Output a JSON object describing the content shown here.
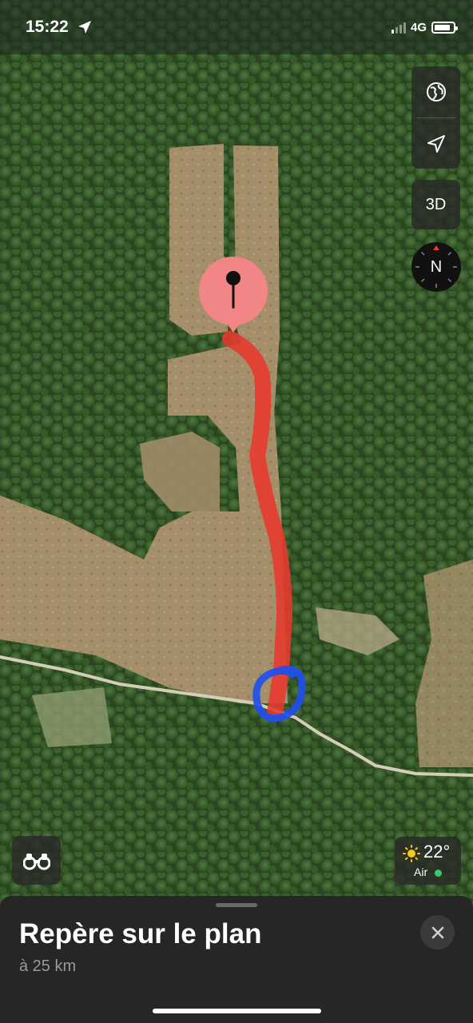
{
  "status_bar": {
    "time": "15:22",
    "network": "4G"
  },
  "map_controls": {
    "three_d_label": "3D",
    "compass_label": "N"
  },
  "weather": {
    "temperature": "22°",
    "air_label": "Air",
    "air_quality_color": "#3ec46d"
  },
  "place_card": {
    "title": "Repère sur le plan",
    "distance": "à 25 km"
  },
  "icons": [
    "location-arrow-icon",
    "globe-icon",
    "navigation-arrow-icon",
    "compass-icon",
    "binoculars-icon",
    "sun-icon",
    "close-icon",
    "map-pin-icon"
  ],
  "colors": {
    "pin": "#f28585",
    "route": "#e8392c",
    "circle": "#1f4ff0"
  }
}
